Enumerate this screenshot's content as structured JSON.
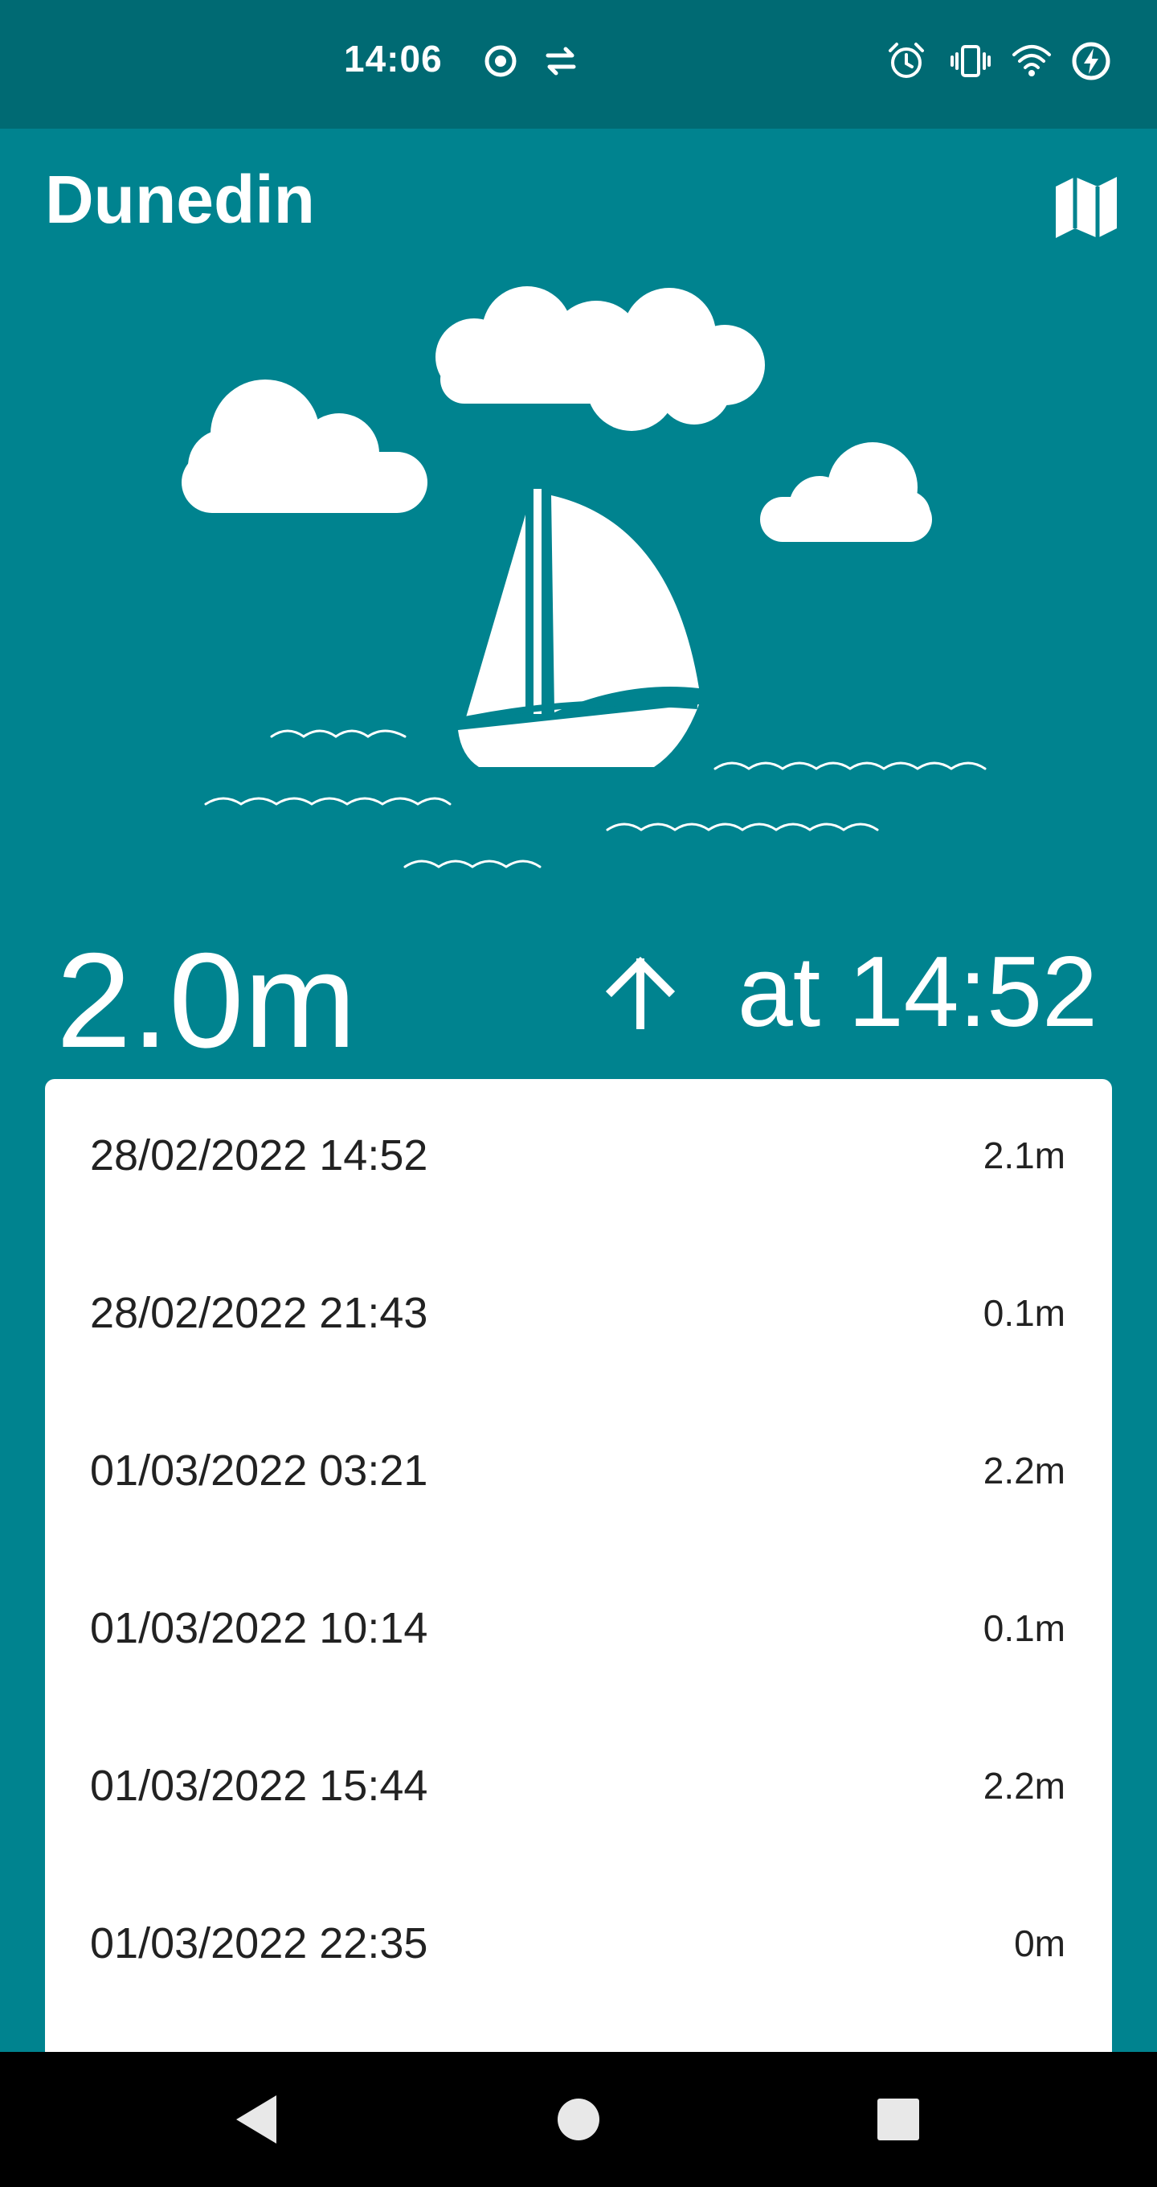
{
  "status_bar": {
    "time": "14:06",
    "icons": [
      "record-icon",
      "data-saver-icon",
      "alarm-icon",
      "vibrate-icon",
      "wifi-icon",
      "battery-charging-icon"
    ]
  },
  "app_bar": {
    "title": "Dunedin",
    "map_icon": "map-icon"
  },
  "current": {
    "height": "2.0m",
    "trend_icon": "arrow-up-icon",
    "trend_text": "at 14:52"
  },
  "tides": [
    {
      "datetime": "28/02/2022 14:52",
      "height": "2.1m"
    },
    {
      "datetime": "28/02/2022 21:43",
      "height": "0.1m"
    },
    {
      "datetime": "01/03/2022 03:21",
      "height": "2.2m"
    },
    {
      "datetime": "01/03/2022 10:14",
      "height": "0.1m"
    },
    {
      "datetime": "01/03/2022 15:44",
      "height": "2.2m"
    },
    {
      "datetime": "01/03/2022 22:35",
      "height": "0m"
    }
  ],
  "nav_bar": {
    "icons": [
      "back-icon",
      "home-icon",
      "recents-icon"
    ]
  },
  "colors": {
    "primary": "#00838f",
    "status_bar": "#006a73",
    "card": "#ffffff",
    "text_on_primary": "#ffffff",
    "list_text": "#222222"
  }
}
